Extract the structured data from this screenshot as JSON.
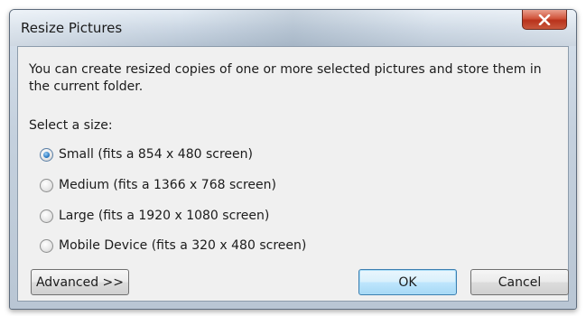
{
  "window": {
    "title": "Resize Pictures",
    "close_glyph": "x"
  },
  "dialog": {
    "description": "You can create resized copies of one or more selected pictures and store them in the current folder.",
    "select_label": "Select a size:",
    "options": [
      {
        "label": "Small (fits a 854 x 480 screen)",
        "checked": true
      },
      {
        "label": "Medium (fits a 1366 x 768 screen)",
        "checked": false
      },
      {
        "label": "Large (fits a 1920 x 1080 screen)",
        "checked": false
      },
      {
        "label": "Mobile Device (fits a 320 x 480 screen)",
        "checked": false
      }
    ]
  },
  "buttons": {
    "advanced": "Advanced >>",
    "ok": "OK",
    "cancel": "Cancel"
  },
  "colors": {
    "close_button": "#c9583d",
    "default_button_border": "#3c7fb1",
    "radio_selected": "#2e7cc4"
  },
  "icons": {
    "close": "close-icon",
    "radio_selected": "radio-selected",
    "radio_empty": "radio-empty"
  }
}
